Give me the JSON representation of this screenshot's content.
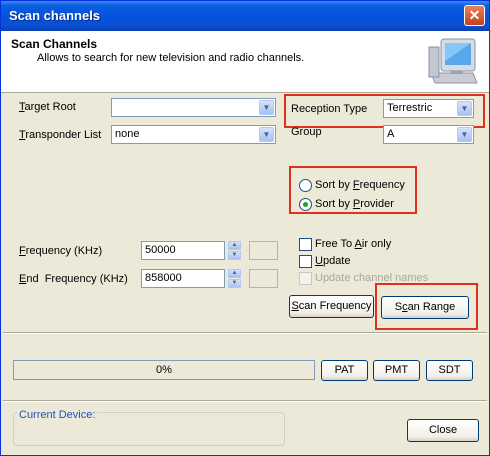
{
  "window": {
    "title": "Scan channels",
    "close_glyph": "✕"
  },
  "header": {
    "title": "Scan Channels",
    "description": "Allows to search for new television and radio channels."
  },
  "form": {
    "target_root": {
      "label": "Target Root",
      "value": ""
    },
    "transponder_list": {
      "label": "Transponder List",
      "value": "none"
    },
    "reception_type": {
      "label": "Reception Type",
      "value": "Terrestric"
    },
    "group": {
      "label": "Group",
      "value": "A"
    },
    "sort_by_frequency": {
      "label": "Sort by Frequency",
      "checked": false
    },
    "sort_by_provider": {
      "label": "Sort by Provider",
      "checked": true
    },
    "frequency": {
      "label": "Frequency (KHz)",
      "value": "50000"
    },
    "end_frequency": {
      "label": "End  Frequency (KHz)",
      "value": "858000"
    },
    "free_to_air_only": {
      "label": "Free To Air only",
      "checked": false
    },
    "update": {
      "label": "Update",
      "checked": false
    },
    "update_channel_names": {
      "label": "Update channel names",
      "checked": false,
      "enabled": false
    }
  },
  "buttons": {
    "scan_frequency": "Scan Frequency",
    "scan_range": "Scan Range",
    "pat": "PAT",
    "pmt": "PMT",
    "sdt": "SDT",
    "close": "Close"
  },
  "progress": {
    "text": "0%",
    "value": 0
  },
  "status": {
    "current_device_label": "Current Device:"
  },
  "colors": {
    "highlight_box": "#e0301e",
    "titlebar": "#0553de",
    "group_label": "#2150c8"
  }
}
